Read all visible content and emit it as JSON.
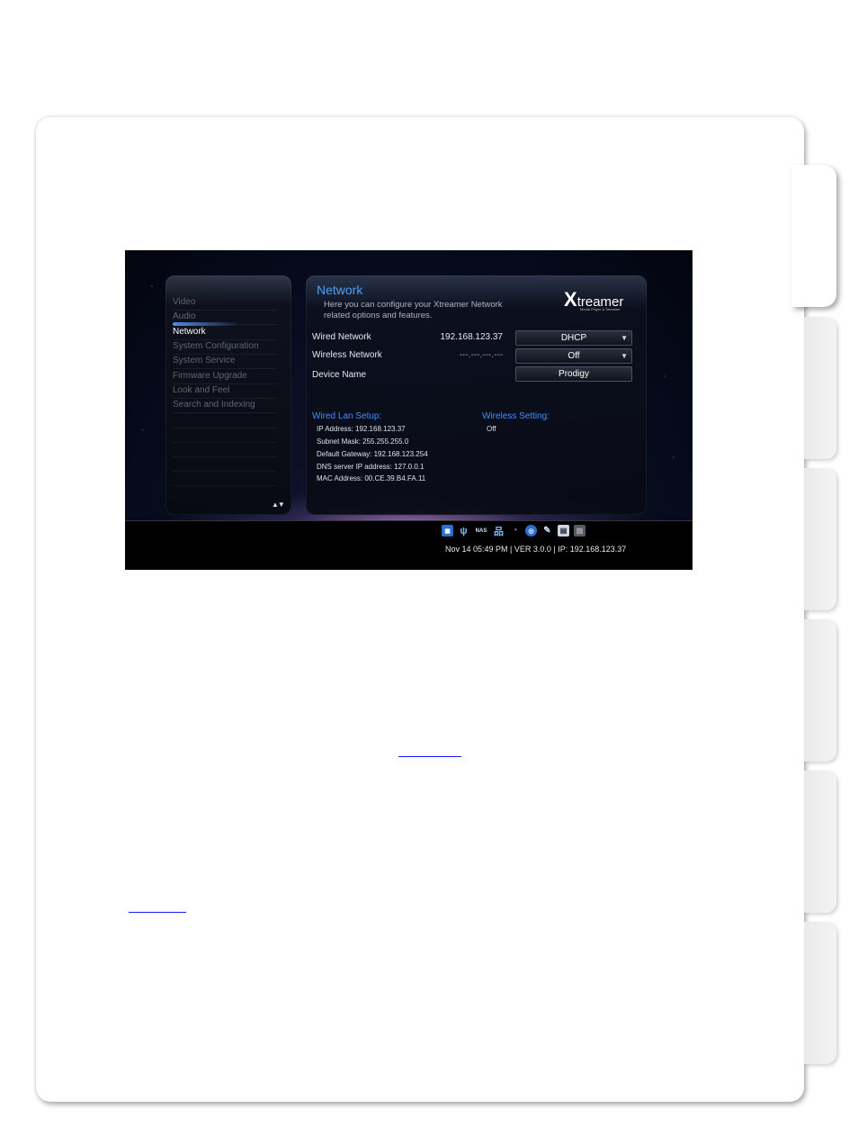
{
  "menu": {
    "items": [
      "Video",
      "Audio",
      "Network",
      "System Configuration",
      "System Service",
      "Firmware Upgrade",
      "Look and Feel",
      "Search and Indexing"
    ],
    "selected": "Network",
    "scroll_arrows": "▲▼"
  },
  "panel": {
    "title": "Network",
    "description_line1": "Here you can configure your Xtreamer Network",
    "description_line2": "related options and features.",
    "logo_main": "treamer",
    "logo_x": "X",
    "logo_tagline": "Media Player & Streamer"
  },
  "settings": {
    "wired": {
      "label": "Wired Network",
      "value": "192.168.123.37",
      "option": "DHCP"
    },
    "wireless": {
      "label": "Wireless Network",
      "value": "---.---.---.---",
      "option": "Off"
    },
    "device": {
      "label": "Device Name",
      "option": "Prodigy"
    },
    "dropdown_arrow": "▼"
  },
  "wired_lan": {
    "heading": "Wired Lan Setup:",
    "ip": "IP Address: 192.168.123.37",
    "subnet": "Subnet Mask: 255.255.255.0",
    "gateway": "Default Gateway: 192.168.123.254",
    "dns": "DNS server IP address: 127.0.0.1",
    "mac": "MAC Address: 00.CE.39.B4.FA.11"
  },
  "wireless_setting": {
    "heading": "Wireless Setting:",
    "value": "Off"
  },
  "statusbar": {
    "icons": [
      "sd-card-icon",
      "usb-icon",
      "nas-icon",
      "lan-icon",
      "wifi-icon",
      "internet-icon",
      "satellite-icon",
      "keyboard-icon",
      "hdd-icon"
    ],
    "nas_label": "NAS",
    "text": "Nov 14 05:49 PM | VER 3.0.0 | IP: 192.168.123.37"
  },
  "colors": {
    "accent": "#4aa0ff",
    "link": "#1a1aff"
  }
}
